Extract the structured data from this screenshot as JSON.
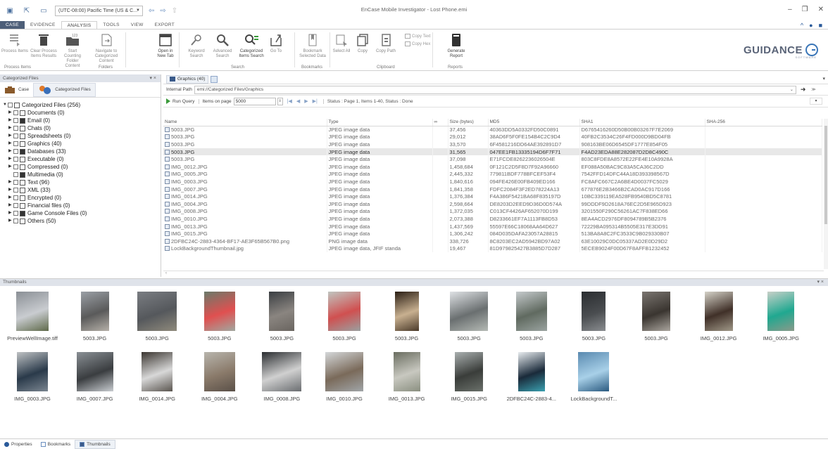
{
  "window": {
    "title": "EnCase Mobile Investigator - Lost Phone.emi",
    "timezone": "(UTC-08:00) Pacific Time (US & C...",
    "controls": [
      "–",
      "❐",
      "✕"
    ]
  },
  "menu": {
    "tabs": [
      "CASE",
      "EVIDENCE",
      "ANALYSIS",
      "TOOLS",
      "VIEW",
      "EXPORT"
    ],
    "active": "ANALYSIS"
  },
  "ribbon": {
    "buttons": [
      {
        "label": "Process Items",
        "icon": "process-items-icon",
        "enabled": false
      },
      {
        "label": "Clear Process Items Results",
        "icon": "trash-icon",
        "enabled": false
      },
      {
        "label": "Start Counting Folder Content",
        "icon": "folder-count-icon",
        "enabled": false
      },
      {
        "label": "Navigate to Categorized Content",
        "icon": "navigate-icon",
        "enabled": false
      },
      {
        "label": "Open in New Tab",
        "icon": "new-tab-icon",
        "enabled": true
      },
      {
        "label": "Keyword Search",
        "icon": "keyword-search-icon",
        "enabled": false
      },
      {
        "label": "Advanced Search",
        "icon": "advanced-search-icon",
        "enabled": false
      },
      {
        "label": "Categorized Items Search",
        "icon": "categorized-search-icon",
        "enabled": true
      },
      {
        "label": "Go To",
        "icon": "go-to-icon",
        "enabled": false
      },
      {
        "label": "Bookmark Selected Data",
        "icon": "bookmark-icon",
        "enabled": false
      },
      {
        "label": "Select All",
        "icon": "select-all-icon",
        "enabled": false
      },
      {
        "label": "Copy",
        "icon": "copy-icon",
        "enabled": false
      },
      {
        "label": "Copy Path",
        "icon": "copy-path-icon",
        "enabled": false
      },
      {
        "label": "Generate Report",
        "icon": "report-icon",
        "enabled": true
      }
    ],
    "small_buttons": [
      "Copy Text",
      "Copy Hex"
    ],
    "groups": [
      "Process Items",
      "Folders",
      "Search",
      "Bookmarks",
      "Clipboard",
      "Reports"
    ],
    "logo": "GUIDANCE",
    "logo_sub": "SOFTWARE"
  },
  "left_pane": {
    "title": "Categorized Files",
    "tabs": [
      "Case",
      "Categorized Files"
    ],
    "tree": [
      {
        "label": "Categorized Files (256)",
        "root": true
      },
      {
        "label": "Documents (0)"
      },
      {
        "label": "Email (0)"
      },
      {
        "label": "Chats (0)"
      },
      {
        "label": "Spreadsheets (0)"
      },
      {
        "label": "Graphics (40)"
      },
      {
        "label": "Databases (33)"
      },
      {
        "label": "Executable (0)"
      },
      {
        "label": "Compressed (0)"
      },
      {
        "label": "Multimedia (0)"
      },
      {
        "label": "Text (96)"
      },
      {
        "label": "XML (33)"
      },
      {
        "label": "Encrypted (0)"
      },
      {
        "label": "Financial files (0)"
      },
      {
        "label": "Game Console Files (0)"
      },
      {
        "label": "Others (50)"
      }
    ]
  },
  "main_pane": {
    "tab_label": "Graphics (40)",
    "path_label": "Internal Path",
    "path_value": "emi://Categorized Files/Graphics",
    "run_query": "Run Query",
    "items_per_page_label": "Items on page",
    "items_per_page": "5000",
    "status": "Status : Page 1, Items 1-40, Status : Done",
    "columns": [
      "Name",
      "Type",
      "∞",
      "Size (bytes)",
      "MD5",
      "SHA1",
      "SHA-256"
    ],
    "rows": [
      [
        "5003.JPG",
        "JPEG image data",
        "",
        "37,456",
        "40363DD5A0332FD50C0891",
        "D6765416260D50B00B03267F7E2069",
        ""
      ],
      [
        "5003.JPG",
        "JPEG image data",
        "",
        "29,012",
        "38AD6F5F0FE154B4C2C9D4",
        "40FB2C3534C26F4FD000D9BD04FB",
        ""
      ],
      [
        "5003.JPG",
        "JPEG image data",
        "",
        "33,570",
        "6F4581216DD64AE392891D7",
        "908163BE06D6545DF1777E854F05",
        ""
      ],
      [
        "5003.JPG",
        "JPEG image data",
        "",
        "31,565",
        "047EE1FB13335194D6F7F71",
        "F4AD23EDA88E282087D2D8C490C",
        ""
      ],
      [
        "5003.JPG",
        "JPEG image data",
        "",
        "37,098",
        "E71FCDE8262236026504E",
        "803C8FDE8A8572E22FE4E10A9928A",
        ""
      ],
      [
        "IMG_0012.JPG",
        "JPEG image data",
        "",
        "1,458,684",
        "0F121C2D5F8D7F92A96660",
        "EF088A50BAC9C83A5CA36C2DD",
        ""
      ],
      [
        "IMG_0005.JPG",
        "JPEG image data",
        "",
        "2,445,332",
        "779811BDF778BFCEF53F4",
        "7542FFD14DFC44A18D393398567D",
        ""
      ],
      [
        "IMG_0003.JPG",
        "JPEG image data",
        "",
        "1,840,616",
        "094FE426E00FB409ED166",
        "FC8AFC667C2A6BE4D0037FC5029",
        ""
      ],
      [
        "IMG_0007.JPG",
        "JPEG image data",
        "",
        "1,841,358",
        "FDFC2084F3F2ED78224A13",
        "677876E2B3466B2CAD0AC917D166",
        ""
      ],
      [
        "IMG_0014.JPG",
        "JPEG image data",
        "",
        "1,376,384",
        "F4A386F5421BA68F835197D",
        "10BC339119EA528FB9540BD5C8781",
        ""
      ],
      [
        "IMG_0004.JPG",
        "JPEG image data",
        "",
        "2,598,664",
        "DE8203D2EED9D36D0D574A",
        "99DDDF9D2618A76EC2D5E965D923",
        ""
      ],
      [
        "IMG_0008.JPG",
        "JPEG image data",
        "",
        "1,372,035",
        "C013CF4426AF652070D199",
        "3201550F290C56261AC7F838ED66",
        ""
      ],
      [
        "IMG_0010.JPG",
        "JPEG image data",
        "",
        "2,073,388",
        "D8233661EF7A1113FB8D53",
        "8EA4ACD2976DF8094789B5B2376",
        ""
      ],
      [
        "IMG_0013.JPG",
        "JPEG image data",
        "",
        "1,437,569",
        "55597E66C18068AA64D627",
        "72229BA095314B5505E317E3DD91",
        ""
      ],
      [
        "IMG_0015.JPG",
        "JPEG image data",
        "",
        "1,306,242",
        "084D035DAFA23057A28815",
        "513BA8A8C2FC3533C9B029330B07",
        ""
      ],
      [
        "2DFBC24C-2883-4364-BF17-AE3F65B567B0.png",
        "PNG image data",
        "",
        "338,726",
        "8C8203EC2AD5942BD97A02",
        "63E10029C0DC05337AD2E0D29D2",
        ""
      ],
      [
        "LockBackgroundThumbnail.jpg",
        "JPEG image data, JFIF standa",
        "",
        "19,467",
        "81D979825427B3885D7D287",
        "5ECEB9024F00D67F8AFFB1232452",
        ""
      ]
    ],
    "selected_row": 3
  },
  "thumbnails": {
    "title": "Thumbnails",
    "row1": [
      "PreviewWellImage.tiff",
      "5003.JPG",
      "5003.JPG",
      "5003.JPG",
      "5003.JPG",
      "5003.JPG",
      "5003.JPG",
      "5003.JPG",
      "5003.JPG",
      "5003.JPG",
      "5003.JPG",
      "IMG_0012.JPG",
      "IMG_0005.JPG"
    ],
    "row2": [
      "IMG_0003.JPG",
      "IMG_0007.JPG",
      "IMG_0014.JPG",
      "IMG_0004.JPG",
      "IMG_0008.JPG",
      "IMG_0010.JPG",
      "IMG_0013.JPG",
      "IMG_0015.JPG",
      "2DFBC24C-2883-4...",
      "LockBackgroundT..."
    ]
  },
  "bottom_tabs": [
    "Properties",
    "Bookmarks",
    "Thumbnails"
  ],
  "colors": {
    "file_tab": "#4d5e78",
    "header_bg": "#dfe3ea",
    "accent": "#2a5a9a"
  }
}
